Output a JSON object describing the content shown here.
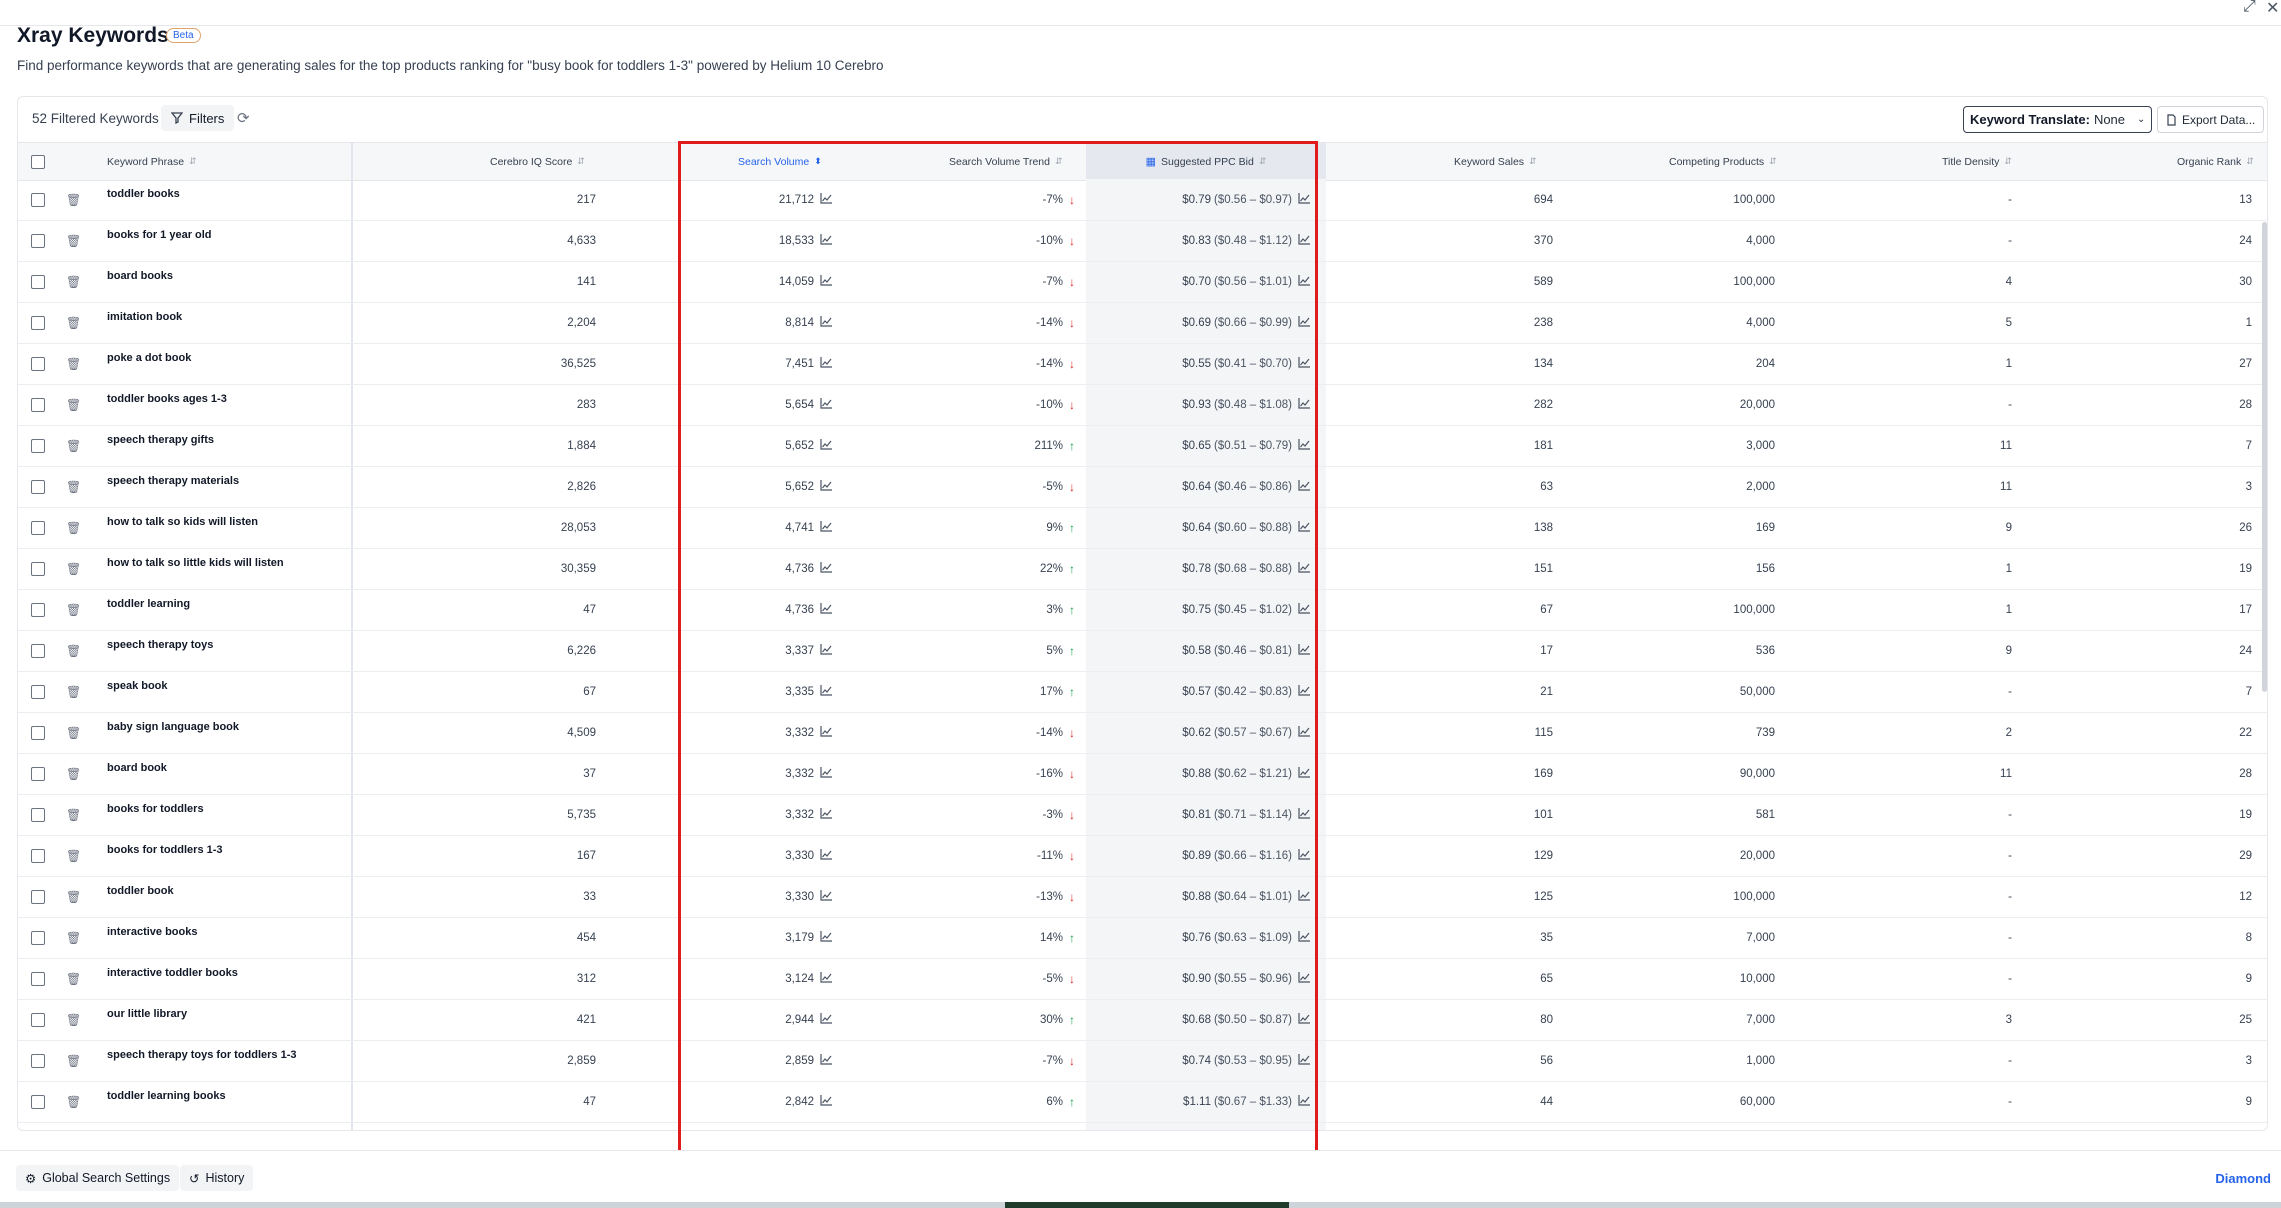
{
  "header": {
    "title": "Xray Keywords",
    "beta": "Beta",
    "subtitle": "Find performance keywords that are generating sales for the top products ranking for \"busy book for toddlers 1-3\" powered by Helium 10 Cerebro"
  },
  "toolbar": {
    "count": "52 Filtered Keywords",
    "filters": "Filters",
    "translate_label": "Keyword Translate:",
    "translate_value": "None",
    "export": "Export Data..."
  },
  "columns": {
    "keyword": "Keyword Phrase",
    "cerebro": "Cerebro IQ Score",
    "volume": "Search Volume",
    "trend": "Search Volume Trend",
    "ppc": "Suggested PPC Bid",
    "sales": "Keyword Sales",
    "competing": "Competing Products",
    "density": "Title Density",
    "rank": "Organic Rank"
  },
  "rows": [
    {
      "kw": "toddler books",
      "iq": "217",
      "vol": "21,712",
      "trend": "-7%",
      "dir": "down",
      "ppc": "$0.79",
      "range": "($0.56 – $0.97)",
      "sales": "694",
      "comp": "100,000",
      "dens": "-",
      "rank": "13"
    },
    {
      "kw": "books for 1 year old",
      "iq": "4,633",
      "vol": "18,533",
      "trend": "-10%",
      "dir": "down",
      "ppc": "$0.83",
      "range": "($0.48 – $1.12)",
      "sales": "370",
      "comp": "4,000",
      "dens": "-",
      "rank": "24"
    },
    {
      "kw": "board books",
      "iq": "141",
      "vol": "14,059",
      "trend": "-7%",
      "dir": "down",
      "ppc": "$0.70",
      "range": "($0.56 – $1.01)",
      "sales": "589",
      "comp": "100,000",
      "dens": "4",
      "rank": "30"
    },
    {
      "kw": "imitation book",
      "iq": "2,204",
      "vol": "8,814",
      "trend": "-14%",
      "dir": "down",
      "ppc": "$0.69",
      "range": "($0.66 – $0.99)",
      "sales": "238",
      "comp": "4,000",
      "dens": "5",
      "rank": "1"
    },
    {
      "kw": "poke a dot book",
      "iq": "36,525",
      "vol": "7,451",
      "trend": "-14%",
      "dir": "down",
      "ppc": "$0.55",
      "range": "($0.41 – $0.70)",
      "sales": "134",
      "comp": "204",
      "dens": "1",
      "rank": "27"
    },
    {
      "kw": "toddler books ages 1-3",
      "iq": "283",
      "vol": "5,654",
      "trend": "-10%",
      "dir": "down",
      "ppc": "$0.93",
      "range": "($0.48 – $1.08)",
      "sales": "282",
      "comp": "20,000",
      "dens": "-",
      "rank": "28"
    },
    {
      "kw": "speech therapy gifts",
      "iq": "1,884",
      "vol": "5,652",
      "trend": "211%",
      "dir": "up",
      "ppc": "$0.65",
      "range": "($0.51 – $0.79)",
      "sales": "181",
      "comp": "3,000",
      "dens": "11",
      "rank": "7"
    },
    {
      "kw": "speech therapy materials",
      "iq": "2,826",
      "vol": "5,652",
      "trend": "-5%",
      "dir": "down",
      "ppc": "$0.64",
      "range": "($0.46 – $0.86)",
      "sales": "63",
      "comp": "2,000",
      "dens": "11",
      "rank": "3"
    },
    {
      "kw": "how to talk so kids will listen",
      "iq": "28,053",
      "vol": "4,741",
      "trend": "9%",
      "dir": "up",
      "ppc": "$0.64",
      "range": "($0.60 – $0.88)",
      "sales": "138",
      "comp": "169",
      "dens": "9",
      "rank": "26"
    },
    {
      "kw": "how to talk so little kids will listen",
      "iq": "30,359",
      "vol": "4,736",
      "trend": "22%",
      "dir": "up",
      "ppc": "$0.78",
      "range": "($0.68 – $0.88)",
      "sales": "151",
      "comp": "156",
      "dens": "1",
      "rank": "19"
    },
    {
      "kw": "toddler learning",
      "iq": "47",
      "vol": "4,736",
      "trend": "3%",
      "dir": "up",
      "ppc": "$0.75",
      "range": "($0.45 – $1.02)",
      "sales": "67",
      "comp": "100,000",
      "dens": "1",
      "rank": "17"
    },
    {
      "kw": "speech therapy toys",
      "iq": "6,226",
      "vol": "3,337",
      "trend": "5%",
      "dir": "up",
      "ppc": "$0.58",
      "range": "($0.46 – $0.81)",
      "sales": "17",
      "comp": "536",
      "dens": "9",
      "rank": "24"
    },
    {
      "kw": "speak book",
      "iq": "67",
      "vol": "3,335",
      "trend": "17%",
      "dir": "up",
      "ppc": "$0.57",
      "range": "($0.42 – $0.83)",
      "sales": "21",
      "comp": "50,000",
      "dens": "-",
      "rank": "7"
    },
    {
      "kw": "baby sign language book",
      "iq": "4,509",
      "vol": "3,332",
      "trend": "-14%",
      "dir": "down",
      "ppc": "$0.62",
      "range": "($0.57 – $0.67)",
      "sales": "115",
      "comp": "739",
      "dens": "2",
      "rank": "22"
    },
    {
      "kw": "board book",
      "iq": "37",
      "vol": "3,332",
      "trend": "-16%",
      "dir": "down",
      "ppc": "$0.88",
      "range": "($0.62 – $1.21)",
      "sales": "169",
      "comp": "90,000",
      "dens": "11",
      "rank": "28"
    },
    {
      "kw": "books for toddlers",
      "iq": "5,735",
      "vol": "3,332",
      "trend": "-3%",
      "dir": "down",
      "ppc": "$0.81",
      "range": "($0.71 – $1.14)",
      "sales": "101",
      "comp": "581",
      "dens": "-",
      "rank": "19"
    },
    {
      "kw": "books for toddlers 1-3",
      "iq": "167",
      "vol": "3,330",
      "trend": "-11%",
      "dir": "down",
      "ppc": "$0.89",
      "range": "($0.66 – $1.16)",
      "sales": "129",
      "comp": "20,000",
      "dens": "-",
      "rank": "29"
    },
    {
      "kw": "toddler book",
      "iq": "33",
      "vol": "3,330",
      "trend": "-13%",
      "dir": "down",
      "ppc": "$0.88",
      "range": "($0.64 – $1.01)",
      "sales": "125",
      "comp": "100,000",
      "dens": "-",
      "rank": "12"
    },
    {
      "kw": "interactive books",
      "iq": "454",
      "vol": "3,179",
      "trend": "14%",
      "dir": "up",
      "ppc": "$0.76",
      "range": "($0.63 – $1.09)",
      "sales": "35",
      "comp": "7,000",
      "dens": "-",
      "rank": "8"
    },
    {
      "kw": "interactive toddler books",
      "iq": "312",
      "vol": "3,124",
      "trend": "-5%",
      "dir": "down",
      "ppc": "$0.90",
      "range": "($0.55 – $0.96)",
      "sales": "65",
      "comp": "10,000",
      "dens": "-",
      "rank": "9"
    },
    {
      "kw": "our little library",
      "iq": "421",
      "vol": "2,944",
      "trend": "30%",
      "dir": "up",
      "ppc": "$0.68",
      "range": "($0.50 – $0.87)",
      "sales": "80",
      "comp": "7,000",
      "dens": "3",
      "rank": "25"
    },
    {
      "kw": "speech therapy toys for toddlers 1-3",
      "iq": "2,859",
      "vol": "2,859",
      "trend": "-7%",
      "dir": "down",
      "ppc": "$0.74",
      "range": "($0.53 – $0.95)",
      "sales": "56",
      "comp": "1,000",
      "dens": "-",
      "rank": "3"
    },
    {
      "kw": "toddler learning books",
      "iq": "47",
      "vol": "2,842",
      "trend": "6%",
      "dir": "up",
      "ppc": "$1.11",
      "range": "($0.67 – $1.33)",
      "sales": "44",
      "comp": "60,000",
      "dens": "-",
      "rank": "9"
    }
  ],
  "footer": {
    "settings": "Global Search Settings",
    "history": "History",
    "plan": "Diamond"
  },
  "colors": {
    "accent": "#2563eb",
    "down": "#dc2626",
    "up": "#16a34a",
    "highlight": "#e01b1b"
  }
}
